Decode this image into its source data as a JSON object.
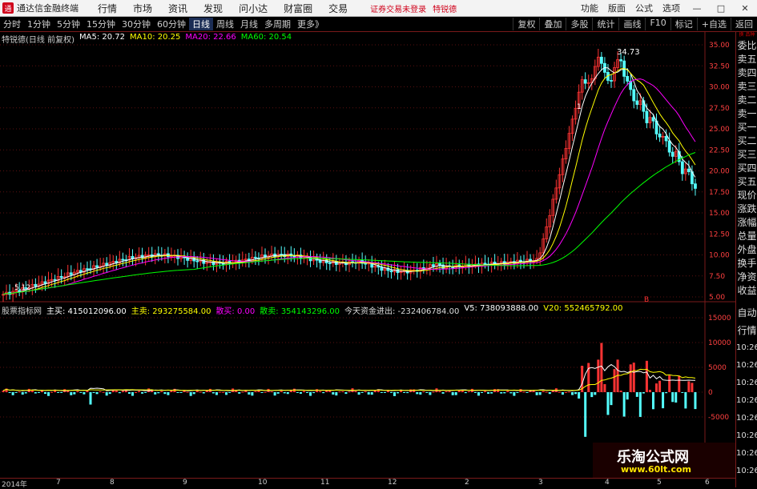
{
  "app": {
    "title": "通达信金融终端",
    "logo_glyph": "通",
    "menu": [
      "行情",
      "市场",
      "资讯",
      "发现",
      "问小达",
      "财富圈",
      "交易"
    ],
    "promo": "证券交易未登录",
    "stock_name": "特锐德",
    "right_menu": [
      "功能",
      "版面",
      "公式",
      "选项"
    ],
    "window_buttons": [
      "—",
      "□",
      "✕"
    ]
  },
  "toolbar": {
    "periods": [
      "分时",
      "1分钟",
      "5分钟",
      "15分钟",
      "30分钟",
      "60分钟",
      "日线",
      "周线",
      "月线",
      "多周期",
      "更多》"
    ],
    "active_period": "日线",
    "tools": [
      "复权",
      "叠加",
      "多股",
      "统计",
      "画线",
      "F10",
      "标记",
      "+自选",
      "返回"
    ]
  },
  "chart_header": {
    "label": "特锐德(日线 前复权)",
    "ma5": "MA5: 20.72",
    "ma10": "MA10: 20.25",
    "ma20": "MA20: 22.66",
    "ma60": "MA60: 20.54"
  },
  "indicator_header": {
    "name": "股票指标网",
    "zhumai": "主买: 415012096.00",
    "zhumai2": "主卖: 293275584.00",
    "sanmai": "散买: 0.00",
    "sanmai2": "散卖: 354143296.00",
    "today": "今天资金进出: -232406784.00",
    "v5": "V5: 738093888.00",
    "v20": "V20: 552465792.00"
  },
  "price_axis": [
    "35.00",
    "32.50",
    "30.00",
    "27.50",
    "25.00",
    "22.50",
    "20.00",
    "17.50",
    "15.00",
    "12.50",
    "10.00",
    "7.50",
    "5.00"
  ],
  "ind_axis": [
    "15000",
    "10000",
    "5000",
    "0",
    "-5000"
  ],
  "annotations": {
    "high": "34.73",
    "low": "5.12",
    "b_marker": "B",
    "one_marker": "1"
  },
  "x_axis": [
    "2014年",
    "7",
    "8",
    "9",
    "10",
    "11",
    "12",
    "2",
    "3",
    "4",
    "5",
    "6"
  ],
  "side_panel": {
    "corner": "换 品种",
    "quote_items": [
      "委比",
      "卖五",
      "卖四",
      "卖三",
      "卖二",
      "卖一",
      "买一",
      "买二",
      "买三",
      "买四",
      "买五",
      "现价",
      "涨跌",
      "涨幅",
      "总量",
      "外盘",
      "换手",
      "净资",
      "收益"
    ],
    "lower_items": [
      "自动",
      "行情",
      "10:26",
      "10:26",
      "10:26",
      "10:26",
      "10:26",
      "10:26",
      "10:26",
      "10:26"
    ]
  },
  "watermark": {
    "title": "乐淘公式网",
    "url": "www.60lt.com"
  },
  "colors": {
    "up": "#ff3333",
    "down": "#54ffff",
    "ma5": "#ffffff",
    "ma10": "#ffff00",
    "ma20": "#ff00ff",
    "ma60": "#00ff00",
    "grid_red": "#7a1a1a"
  }
}
